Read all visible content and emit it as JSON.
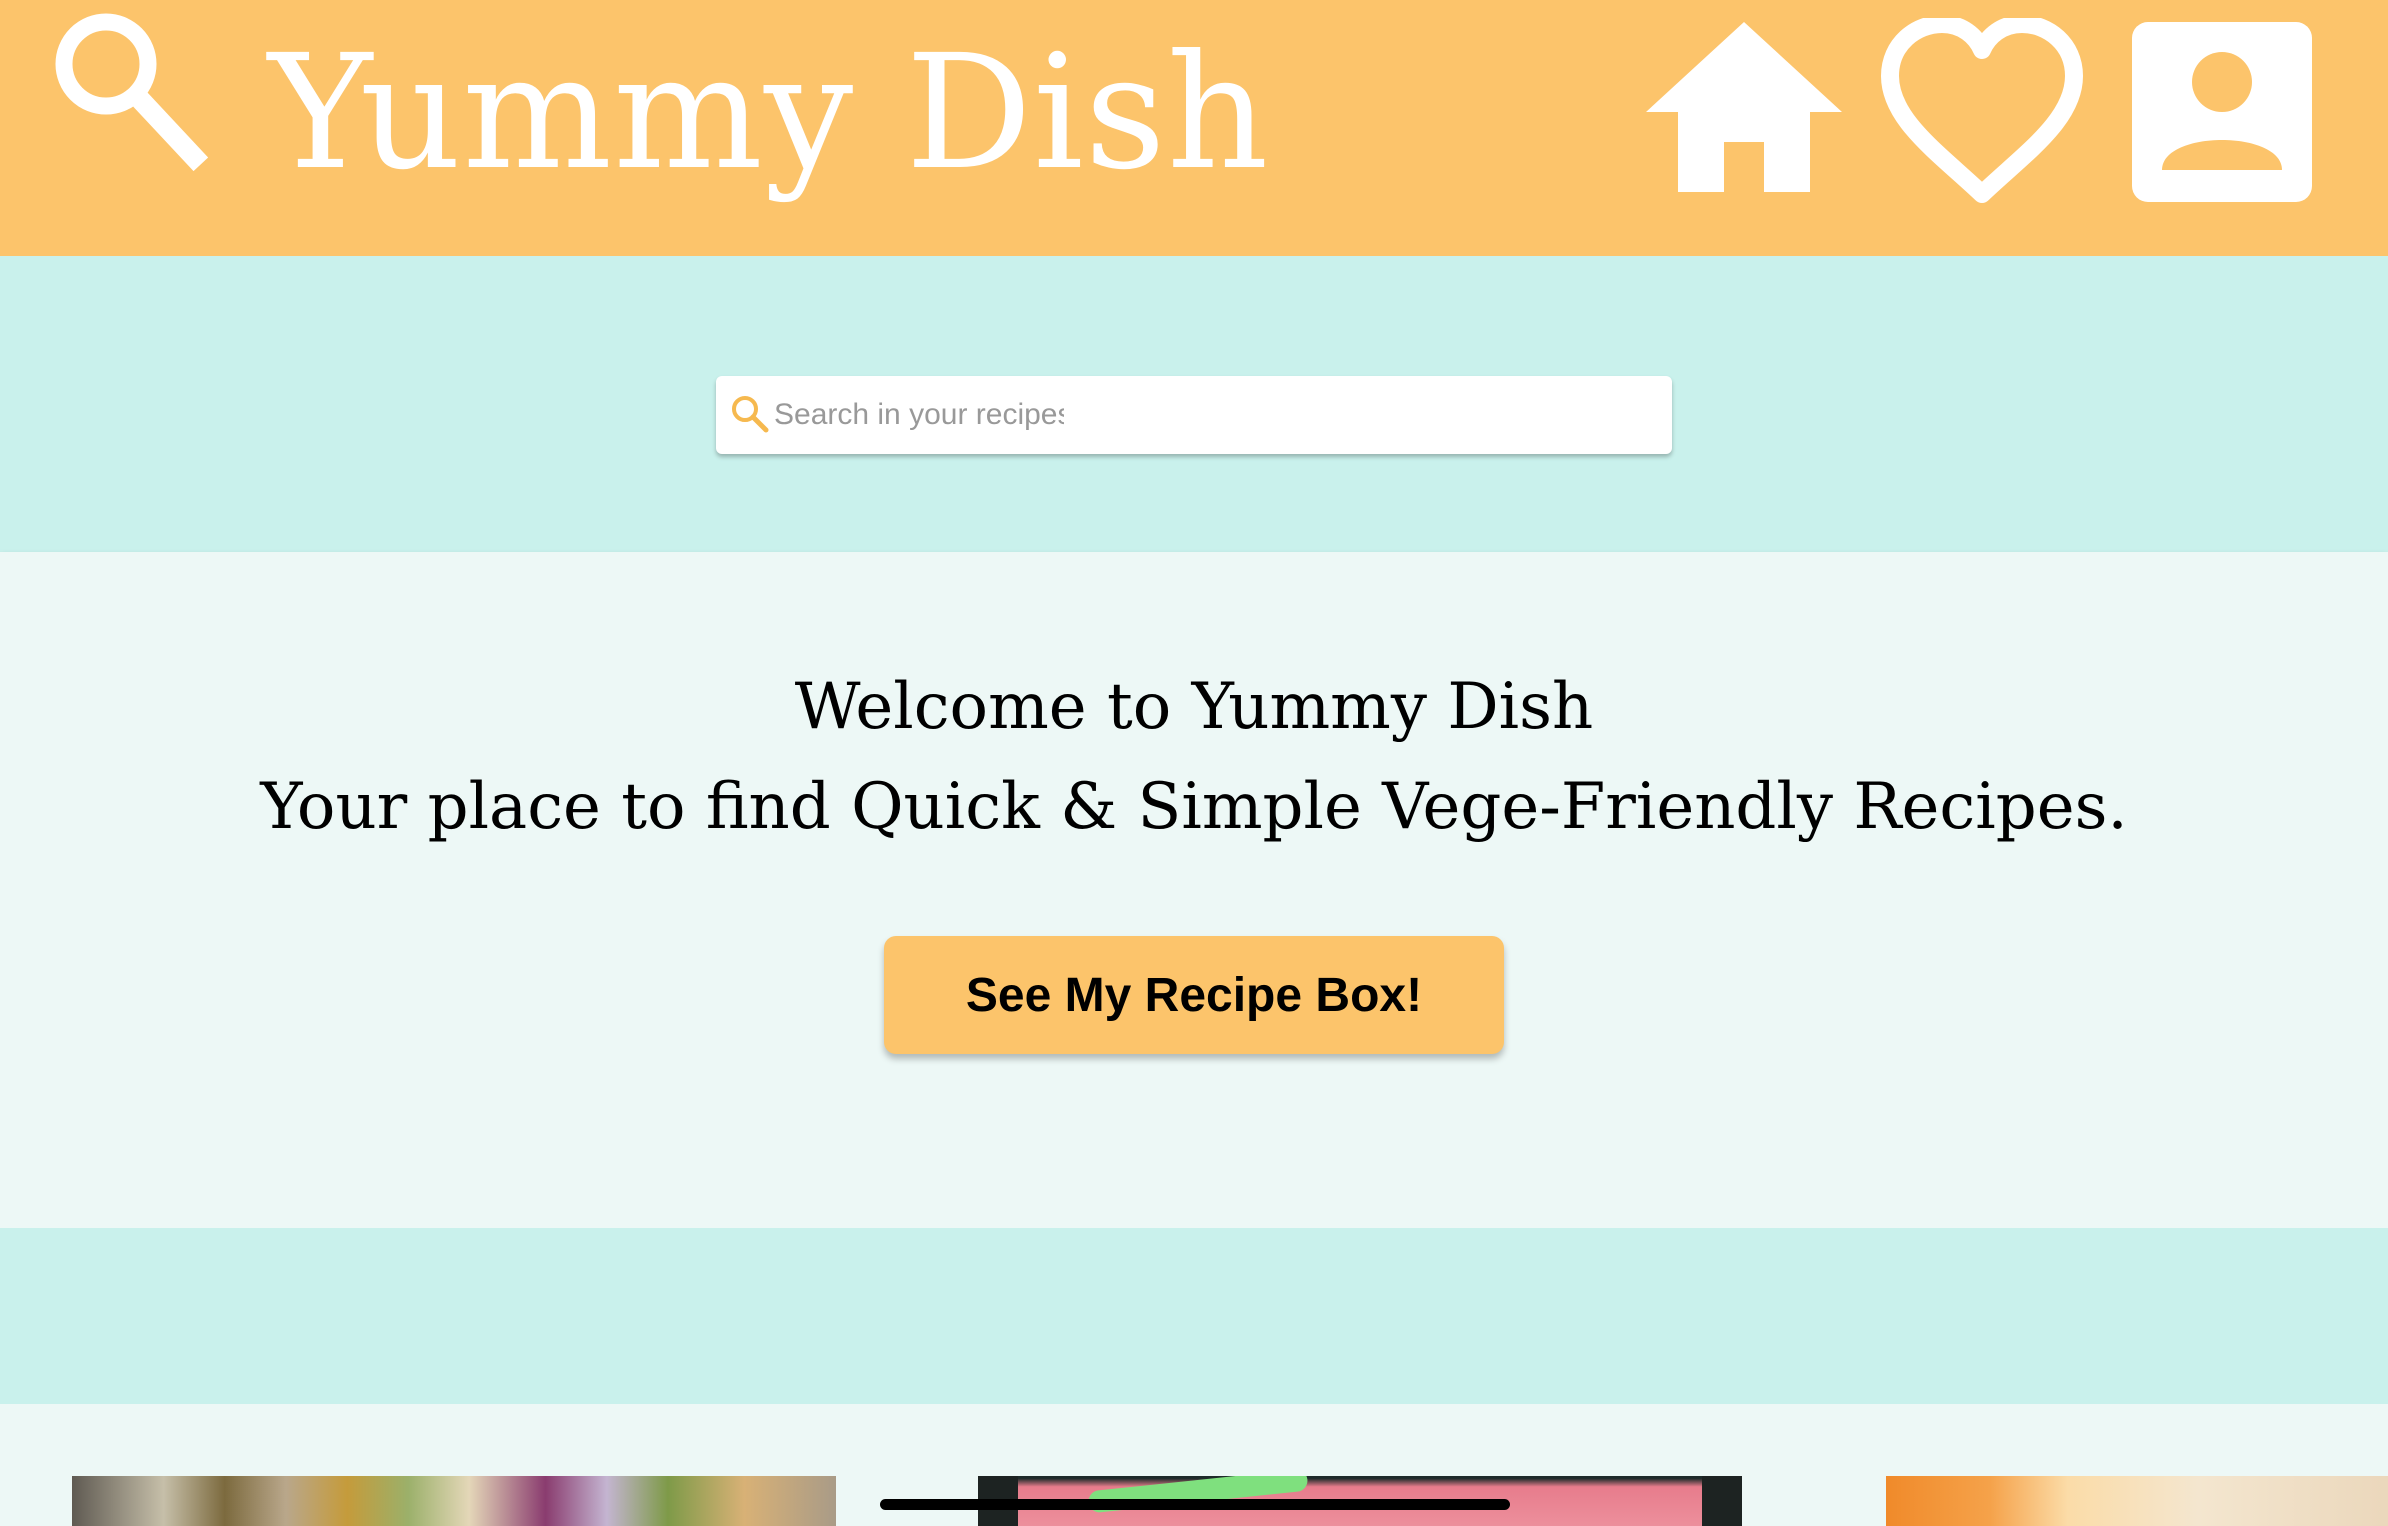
{
  "header": {
    "title": "Yummy Dish",
    "icons": {
      "search": "search-icon",
      "home": "home-icon",
      "favorites": "heart-icon",
      "profile": "profile-icon"
    },
    "background_color": "#fcc46b",
    "icon_color": "#ffffff"
  },
  "search": {
    "placeholder": "Search in your recipes",
    "value": "",
    "icon": "search-icon",
    "icon_color": "#f6b94f"
  },
  "welcome": {
    "line1": "Welcome to Yummy Dish",
    "line2": "Your place to find Quick & Simple Vege-Friendly Recipes.",
    "cta_label": "See My Recipe Box!"
  },
  "cards": [
    {
      "name": "recipe-card-salad"
    },
    {
      "name": "recipe-card-smoothie"
    },
    {
      "name": "recipe-card-dish"
    }
  ],
  "colors": {
    "accent": "#fcc46b",
    "band": "#c9f1ec",
    "panel": "#edf8f6"
  }
}
